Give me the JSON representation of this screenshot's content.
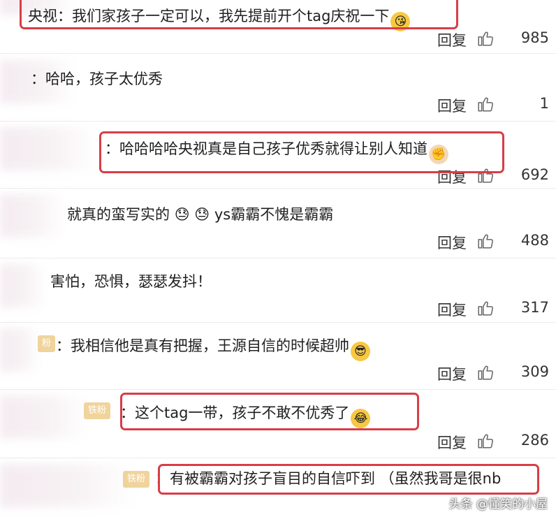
{
  "comments": [
    {
      "text": "央视：我们家孩子一定可以，我先提前开个tag庆祝一下",
      "emoji": "😘",
      "reply": "回复",
      "likes": "985"
    },
    {
      "text": "：哈哈，孩子太优秀",
      "emoji": "",
      "reply": "回复",
      "likes": "1"
    },
    {
      "text": "：哈哈哈哈央视真是自己孩子优秀就得让别人知道",
      "emoji": "✊",
      "reply": "回复",
      "likes": "692"
    },
    {
      "text": "就真的蛮写实的",
      "emoji": "😓 😓",
      "tail": "ys霸霸不愧是霸霸",
      "reply": "回复",
      "likes": "488"
    },
    {
      "text": "害怕，恐惧，瑟瑟发抖！",
      "emoji": "",
      "reply": "回复",
      "likes": "317"
    },
    {
      "badge": "粉",
      "text": "：我相信他是真有把握，王源自信的时候超帅",
      "emoji": "😎",
      "reply": "回复",
      "likes": "309"
    },
    {
      "badge": "铁粉",
      "text": "：这个tag一带，孩子不敢不优秀了",
      "emoji": "😂",
      "reply": "回复",
      "likes": "286"
    },
    {
      "badge": "铁粉",
      "text": "：有被霸霸对孩子盲目的自信吓到 （虽然我哥是很nb",
      "emoji": "",
      "reply": "",
      "likes": ""
    }
  ],
  "watermark": "头条 @懂笑的小屋",
  "colors": {
    "highlight": "#d93d46",
    "divider": "#ececec",
    "badge": "#e5b24c"
  },
  "icons": {
    "like": "thumbs-up-icon"
  }
}
